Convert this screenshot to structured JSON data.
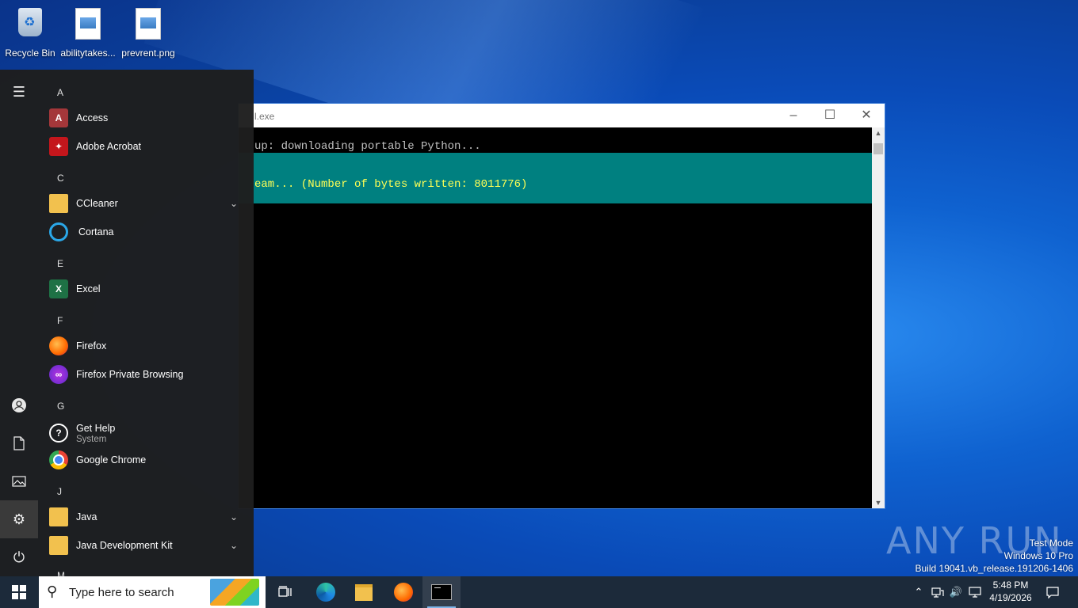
{
  "desktop": {
    "icons": [
      {
        "label": "Recycle Bin",
        "icon": "recycle-bin-icon"
      },
      {
        "label": "abilitytakes...",
        "icon": "image-file-icon"
      },
      {
        "label": "prevrent.png",
        "icon": "image-file-icon"
      }
    ]
  },
  "console": {
    "title": "l.exe",
    "line1": "up: downloading portable Python...",
    "line2": "eam... (Number of bytes written: 8011776)",
    "progress_color": "#008080",
    "line2_color": "#ffff55"
  },
  "start_menu": {
    "groups": [
      {
        "letter": "A",
        "apps": [
          {
            "label": "Access",
            "icon": "access-icon",
            "color": "#a4373a"
          },
          {
            "label": "Adobe Acrobat",
            "icon": "acrobat-icon",
            "color": "#c4161c"
          }
        ]
      },
      {
        "letter": "C",
        "apps": [
          {
            "label": "CCleaner",
            "icon": "folder-icon",
            "expandable": true
          },
          {
            "label": "Cortana",
            "icon": "cortana-icon"
          }
        ]
      },
      {
        "letter": "E",
        "apps": [
          {
            "label": "Excel",
            "icon": "excel-icon",
            "color": "#1e7145"
          }
        ]
      },
      {
        "letter": "F",
        "apps": [
          {
            "label": "Firefox",
            "icon": "firefox-icon"
          },
          {
            "label": "Firefox Private Browsing",
            "icon": "firefox-private-icon"
          }
        ]
      },
      {
        "letter": "G",
        "apps": [
          {
            "label": "Get Help",
            "sub": "System",
            "icon": "get-help-icon"
          },
          {
            "label": "Google Chrome",
            "icon": "chrome-icon"
          }
        ]
      },
      {
        "letter": "J",
        "apps": [
          {
            "label": "Java",
            "icon": "folder-icon",
            "expandable": true
          },
          {
            "label": "Java Development Kit",
            "icon": "folder-icon",
            "expandable": true
          }
        ]
      },
      {
        "letter": "M",
        "apps": []
      }
    ],
    "rail": [
      "hamburger-icon",
      "user-icon",
      "documents-icon",
      "pictures-icon",
      "settings-icon",
      "power-icon"
    ]
  },
  "taskbar": {
    "search_placeholder": "Type here to search",
    "pinned": [
      "task-view-icon",
      "edge-icon",
      "file-explorer-icon",
      "firefox-icon",
      "console-icon"
    ],
    "time": "5:48 PM",
    "date": "4/19/2026"
  },
  "watermark": {
    "line1": "Test Mode",
    "line2": "Windows 10 Pro",
    "line3": "Build 19041.vb_release.191206-1406",
    "brand": "ANY RUN"
  }
}
